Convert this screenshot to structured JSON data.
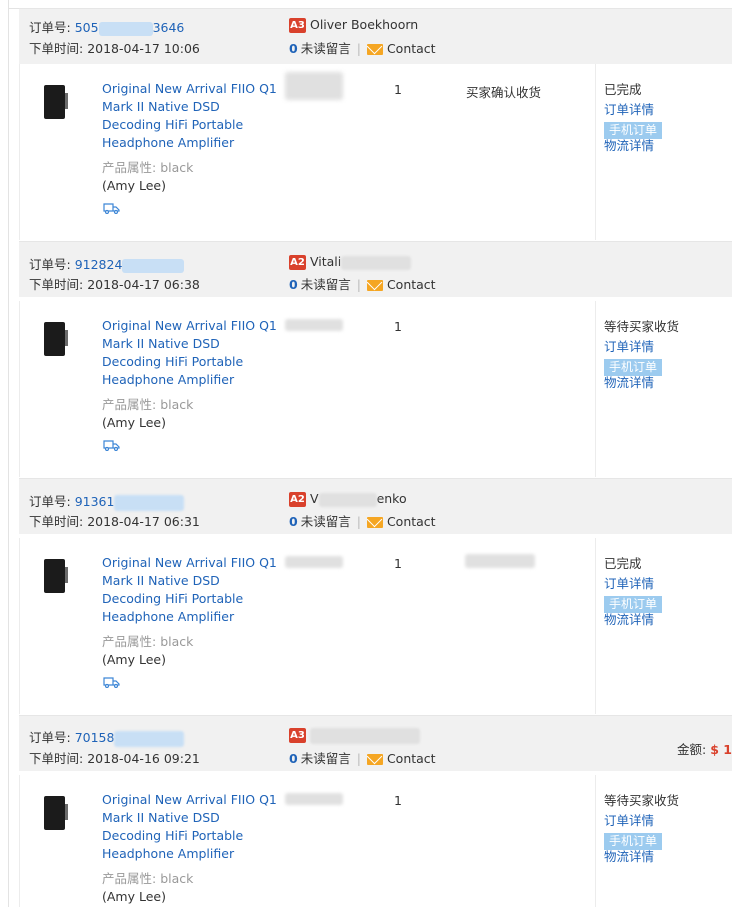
{
  "labels": {
    "order_no": "订单号:",
    "order_time": "下单时间:",
    "unread": "未读留言",
    "contact": "Contact",
    "attr": "产品属性:",
    "order_detail": "订单详情",
    "mobile_order": "手机订单",
    "logistics": "物流详情",
    "amount": "金额:",
    "currency": "$ 1"
  },
  "orders": [
    {
      "no_prefix": "505",
      "no_suffix": "3646",
      "time": "2018-04-17 10:06",
      "level": "A3",
      "buyer": "Oliver Boekhoorn",
      "unread": "0",
      "product_title": "Original New Arrival FIIO Q1 Mark II Native DSD Decoding HiFi Portable Headphone Amplifier",
      "attr_value": "black",
      "model": "(Amy Lee)",
      "qty": "1",
      "ship_status": "买家确认收货",
      "status": "已完成"
    },
    {
      "no_prefix": "912824",
      "no_suffix": "",
      "time": "2018-04-17 06:38",
      "level": "A2",
      "buyer": "Vitali",
      "unread": "0",
      "product_title": "Original New Arrival FIIO Q1 Mark II Native DSD Decoding HiFi Portable Headphone Amplifier",
      "attr_value": "black",
      "model": "(Amy Lee)",
      "qty": "1",
      "ship_status": "",
      "status": "等待买家收货"
    },
    {
      "no_prefix": "91361",
      "no_suffix": "",
      "time": "2018-04-17 06:31",
      "level": "A2",
      "buyer": "V",
      "buyer_tail": "enko",
      "unread": "0",
      "product_title": "Original New Arrival FIIO Q1 Mark II Native DSD Decoding HiFi Portable Headphone Amplifier",
      "attr_value": "black",
      "model": "(Amy Lee)",
      "qty": "1",
      "ship_status": "",
      "status": "已完成"
    },
    {
      "no_prefix": "70158",
      "no_suffix": "",
      "time": "2018-04-16 09:21",
      "level": "A3",
      "buyer": "",
      "unread": "0",
      "product_title": "Original New Arrival FIIO Q1 Mark II Native DSD Decoding HiFi Portable Headphone Amplifier",
      "attr_value": "black",
      "model": "(Amy Lee)",
      "qty": "1",
      "ship_status": "",
      "status": "等待买家收货"
    }
  ]
}
